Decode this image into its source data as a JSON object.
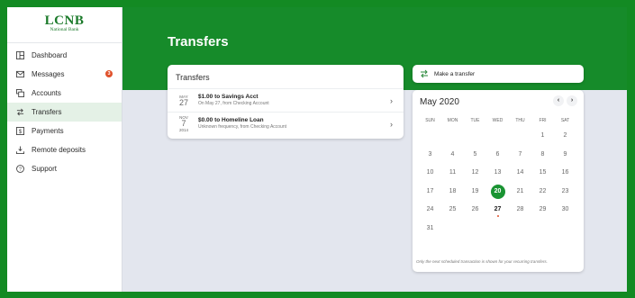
{
  "bank": {
    "logo_main": "LCNB",
    "logo_sub": "National Bank"
  },
  "sidebar": {
    "items": [
      {
        "label": "Dashboard",
        "icon": "dashboard-icon"
      },
      {
        "label": "Messages",
        "icon": "envelope-icon",
        "badge": "3"
      },
      {
        "label": "Accounts",
        "icon": "accounts-icon"
      },
      {
        "label": "Transfers",
        "icon": "transfer-arrows-icon",
        "active": true
      },
      {
        "label": "Payments",
        "icon": "dollar-icon"
      },
      {
        "label": "Remote deposits",
        "icon": "deposit-download-icon"
      },
      {
        "label": "Support",
        "icon": "help-circle-icon"
      }
    ]
  },
  "header": {
    "title": "Transfers"
  },
  "transfers": {
    "title": "Transfers",
    "items": [
      {
        "month": "May",
        "day": "27",
        "year": "",
        "title": "$1.00 to Savings Acct",
        "subtitle": "On May 27, from Checking Account"
      },
      {
        "month": "Nov",
        "day": "7",
        "year": "2014",
        "title": "$0.00 to Homeline Loan",
        "subtitle": "Unknown frequency, from Checking Account"
      }
    ]
  },
  "make_transfer": {
    "label": "Make a transfer"
  },
  "calendar": {
    "month_label": "May 2020",
    "prev": "‹",
    "next": "›",
    "days_of_week": [
      "SUN",
      "MON",
      "TUE",
      "WED",
      "THU",
      "FRI",
      "SAT"
    ],
    "first_weekday": 5,
    "days_in_month": 31,
    "today": 20,
    "scheduled": [
      27
    ],
    "note": "Only the next scheduled transaction is shown for your recurring transfers."
  },
  "colors": {
    "brand_green": "#168b2a",
    "today_green": "#1a9433",
    "badge_red": "#e0512b",
    "active_bg": "#e4f1e6"
  }
}
